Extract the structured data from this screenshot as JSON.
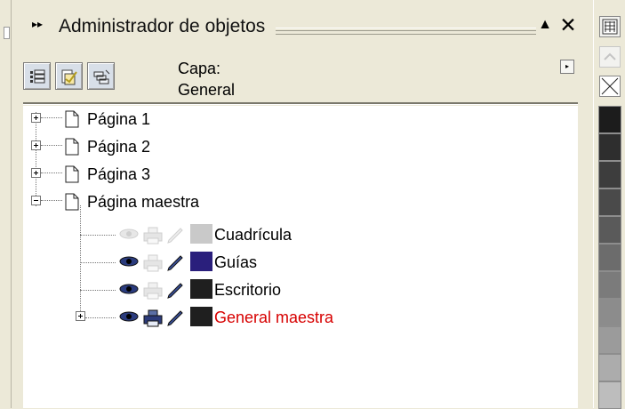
{
  "docker": {
    "title": "Administrador de objetos",
    "arrows": "▸▸",
    "collapse_glyph": "▲",
    "close_glyph": "✕"
  },
  "toolbar": {
    "layer_label": "Capa:",
    "layer_value": "General",
    "menu_arrow": "▸",
    "buttons": [
      "show-object-properties",
      "edit-across-layers",
      "layer-manager-view"
    ]
  },
  "tree": {
    "pages": [
      {
        "label": "Página 1",
        "state": "collapsed"
      },
      {
        "label": "Página 2",
        "state": "collapsed"
      },
      {
        "label": "Página 3",
        "state": "collapsed"
      },
      {
        "label": "Página maestra",
        "state": "expanded"
      }
    ],
    "layers": [
      {
        "label": "Cuadrícula",
        "swatch": "#c9c9c9",
        "visible": false,
        "printable": false,
        "editable": false,
        "color": "#000000"
      },
      {
        "label": "Guías",
        "swatch": "#2a1f7c",
        "visible": true,
        "printable": false,
        "editable": true,
        "color": "#000000"
      },
      {
        "label": "Escritorio",
        "swatch": "#1f1f1f",
        "visible": true,
        "printable": false,
        "editable": true,
        "color": "#000000"
      },
      {
        "label": "General maestra",
        "swatch": "#1f1f1f",
        "visible": true,
        "printable": true,
        "editable": true,
        "color": "#d70000"
      }
    ]
  },
  "palette": {
    "swatches": [
      "#1c1c1c",
      "#2e2e2e",
      "#3d3d3d",
      "#4a4a4a",
      "#5a5a5a",
      "#6c6c6c",
      "#7b7b7b",
      "#8c8c8c",
      "#9b9b9b",
      "#acacac",
      "#bdbdbd"
    ]
  }
}
